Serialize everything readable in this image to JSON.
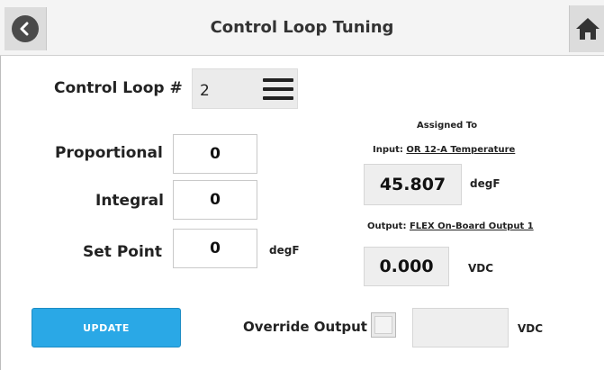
{
  "header": {
    "title": "Control Loop Tuning",
    "back_icon": "chevron-left-circle-icon",
    "home_icon": "home-icon"
  },
  "control_loop": {
    "label": "Control Loop #",
    "value": "2",
    "menu_icon": "hamburger-menu-icon"
  },
  "params": {
    "proportional_label": "Proportional",
    "proportional_value": "0",
    "integral_label": "Integral",
    "integral_value": "0",
    "setpoint_label": "Set Point",
    "setpoint_value": "0",
    "setpoint_unit": "degF"
  },
  "assigned": {
    "heading": "Assigned To",
    "input_prefix": "Input:",
    "input_name": "OR 12-A Temperature",
    "input_value": "45.807",
    "input_unit": "degF",
    "output_prefix": "Output:",
    "output_name": "FLEX On-Board Output 1",
    "output_value": "0.000",
    "output_unit": "VDC"
  },
  "footer": {
    "update_label": "UPDATE",
    "override_label": "Override Output",
    "override_value": "",
    "override_unit": "VDC"
  },
  "colors": {
    "accent": "#2aa8e6",
    "header_bg": "#f4f4f4"
  }
}
